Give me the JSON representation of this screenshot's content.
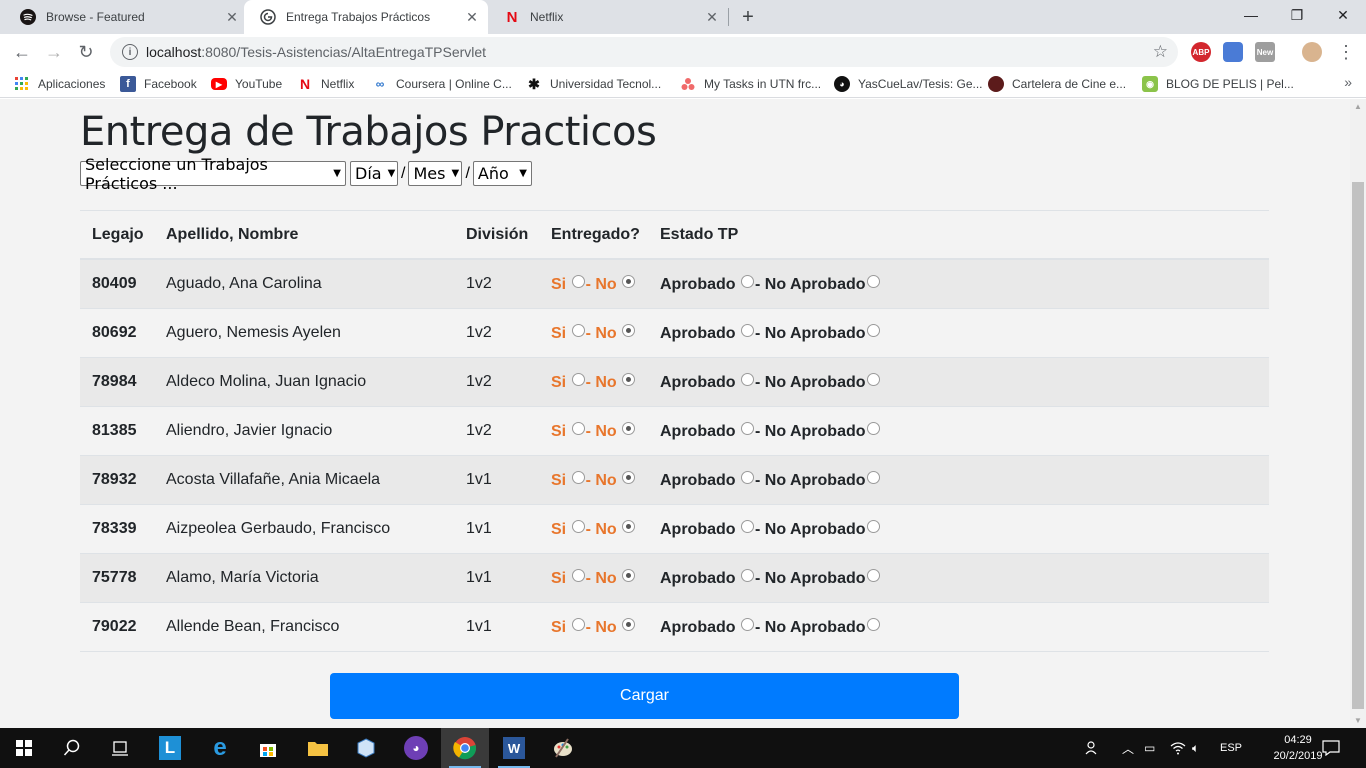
{
  "browser": {
    "tabs": [
      {
        "title": "Browse - Featured",
        "icon": "spotify-icon",
        "active": false
      },
      {
        "title": "Entrega Trabajos Prácticos",
        "icon": "globe-icon",
        "active": true
      },
      {
        "title": "Netflix",
        "icon": "netflix-icon",
        "active": false
      }
    ],
    "url_host": "localhost",
    "url_rest": ":8080/Tesis-Asistencias/AltaEntregaTPServlet",
    "bookmarks": [
      {
        "label": "Aplicaciones",
        "icon": "apps-grid-icon"
      },
      {
        "label": "Facebook",
        "icon": "facebook-icon"
      },
      {
        "label": "YouTube",
        "icon": "youtube-icon"
      },
      {
        "label": "Netflix",
        "icon": "netflix-icon"
      },
      {
        "label": "Coursera | Online C...",
        "icon": "coursera-icon"
      },
      {
        "label": "Universidad Tecnol...",
        "icon": "utn-icon"
      },
      {
        "label": "My Tasks in UTN frc...",
        "icon": "asana-icon"
      },
      {
        "label": "YasCueLav/Tesis: Ge...",
        "icon": "github-icon"
      },
      {
        "label": "Cartelera de Cine e...",
        "icon": "cinema-icon"
      },
      {
        "label": "BLOG DE PELIS | Pel...",
        "icon": "blog-icon"
      }
    ],
    "extensions": [
      {
        "label": "ABP",
        "icon": "adblock-icon",
        "color": "#d3272e"
      },
      {
        "label": "",
        "icon": "cube-icon",
        "color": "#4a7bd6"
      },
      {
        "label": "New",
        "icon": "new-extension-icon",
        "color": "#9e9e9e"
      }
    ]
  },
  "page": {
    "title": "Entrega de Trabajos Practicos",
    "filters": {
      "tp": "Seleccione un Trabajos Prácticos ...",
      "dia": "Día",
      "mes": "Mes",
      "anio": "Año",
      "separator": "/"
    },
    "table": {
      "headers": [
        "Legajo",
        "Apellido, Nombre",
        "División",
        "Entregado?",
        "Estado TP"
      ],
      "rows": [
        {
          "legajo": "80409",
          "nombre": "Aguado, Ana Carolina",
          "division": "1v2"
        },
        {
          "legajo": "80692",
          "nombre": "Aguero, Nemesis Ayelen",
          "division": "1v2"
        },
        {
          "legajo": "78984",
          "nombre": "Aldeco Molina, Juan Ignacio",
          "division": "1v2"
        },
        {
          "legajo": "81385",
          "nombre": "Aliendro, Javier Ignacio",
          "division": "1v2"
        },
        {
          "legajo": "78932",
          "nombre": "Acosta Villafañe, Ania Micaela",
          "division": "1v1"
        },
        {
          "legajo": "78339",
          "nombre": "Aizpeolea Gerbaudo, Francisco",
          "division": "1v1"
        },
        {
          "legajo": "75778",
          "nombre": "Alamo, María Victoria",
          "division": "1v1"
        },
        {
          "legajo": "79022",
          "nombre": "Allende Bean, Francisco",
          "division": "1v1"
        }
      ],
      "entregado": {
        "si": "Si",
        "dash": "- ",
        "no": "No",
        "selected": "No"
      },
      "estado": {
        "aprobado": "Aprobado",
        "dash": "- ",
        "no_aprobado": "No Aprobado"
      }
    },
    "submit_label": "Cargar"
  },
  "taskbar": {
    "items": [
      "windows-start-icon",
      "search-icon",
      "task-view-icon",
      "app-l-icon",
      "edge-icon",
      "store-icon",
      "file-explorer-icon",
      "virtualbox-icon",
      "github-desktop-icon",
      "chrome-icon",
      "word-icon",
      "paint-icon"
    ],
    "language": "ESP",
    "time": "04:29",
    "date": "20/2/2019"
  },
  "colors": {
    "accent": "#007bff",
    "entregado_text": "#e8762c",
    "row_stripe": "#e9e9e9",
    "page_bg": "#f3f3f3"
  }
}
